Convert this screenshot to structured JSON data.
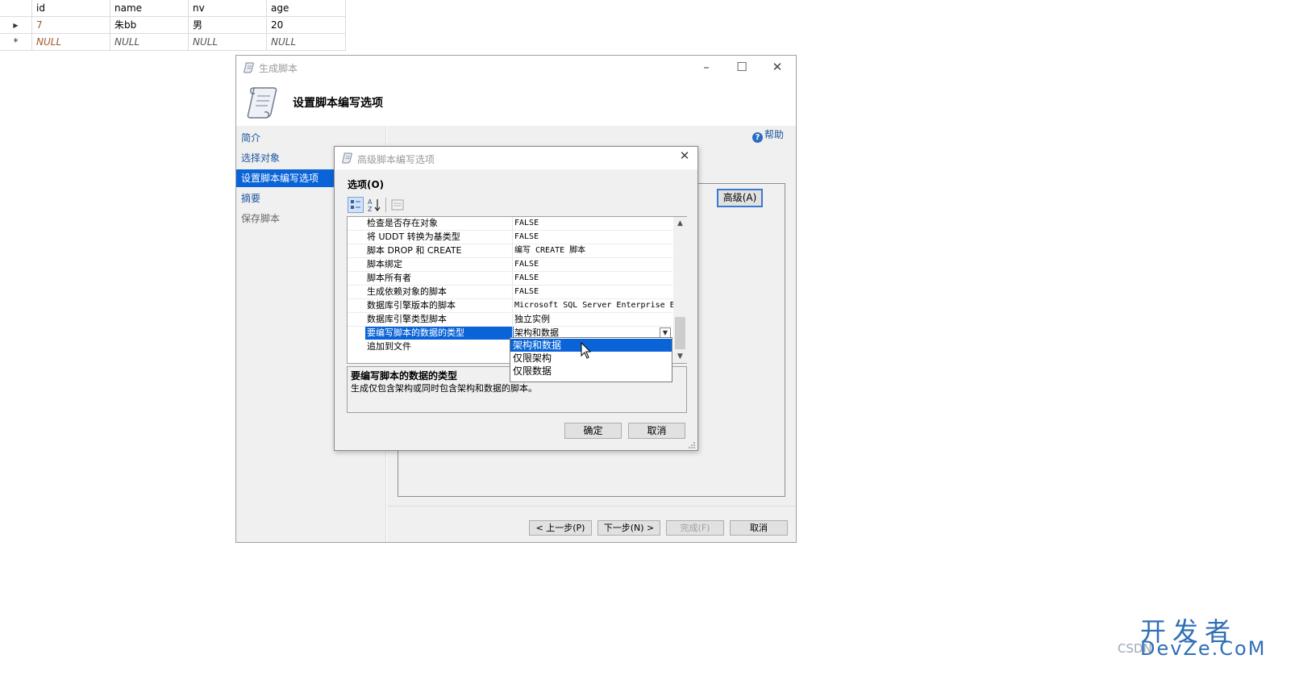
{
  "grid": {
    "columns": [
      "id",
      "name",
      "nv",
      "age"
    ],
    "rows": [
      {
        "marker": "▶",
        "cells": [
          "7",
          "朱bb",
          "男",
          "20"
        ]
      },
      {
        "marker": "*",
        "cells": [
          "NULL",
          "NULL",
          "NULL",
          "NULL"
        ]
      }
    ]
  },
  "wizard": {
    "title": "生成脚本",
    "heading": "设置脚本编写选项",
    "nav": [
      "简介",
      "选择对象",
      "设置脚本编写选项",
      "摘要",
      "保存脚本"
    ],
    "help": "帮助",
    "advanced_button": "高级(A)",
    "footer_buttons": {
      "prev": "< 上一步(P)",
      "next": "下一步(N) >",
      "finish": "完成(F)",
      "cancel": "取消"
    }
  },
  "dialog": {
    "title": "高级脚本编写选项",
    "options_label": "选项(O)",
    "properties": [
      {
        "name": "检查是否存在对象",
        "value": "FALSE"
      },
      {
        "name": "将 UDDT 转换为基类型",
        "value": "FALSE"
      },
      {
        "name": "脚本 DROP 和 CREATE",
        "value": "编写 CREATE 脚本"
      },
      {
        "name": "脚本绑定",
        "value": "FALSE"
      },
      {
        "name": "脚本所有者",
        "value": "FALSE"
      },
      {
        "name": "生成依赖对象的脚本",
        "value": "FALSE"
      },
      {
        "name": "数据库引擎版本的脚本",
        "value": "Microsoft SQL Server Enterprise Ed"
      },
      {
        "name": "数据库引擎类型脚本",
        "value": "独立实例"
      },
      {
        "name": "要编写脚本的数据的类型",
        "value": "架构和数据"
      },
      {
        "name": "追加到文件",
        "value": ""
      }
    ],
    "dropdown_options": [
      "架构和数据",
      "仅限架构",
      "仅限数据"
    ],
    "description_title": "要编写脚本的数据的类型",
    "description_text": "生成仅包含架构或同时包含架构和数据的脚本。",
    "ok_button": "确定",
    "cancel_button": "取消"
  },
  "watermark": {
    "logo": "开发者",
    "logo_en": "DevZe.CoM",
    "csdn": "CSDN"
  }
}
